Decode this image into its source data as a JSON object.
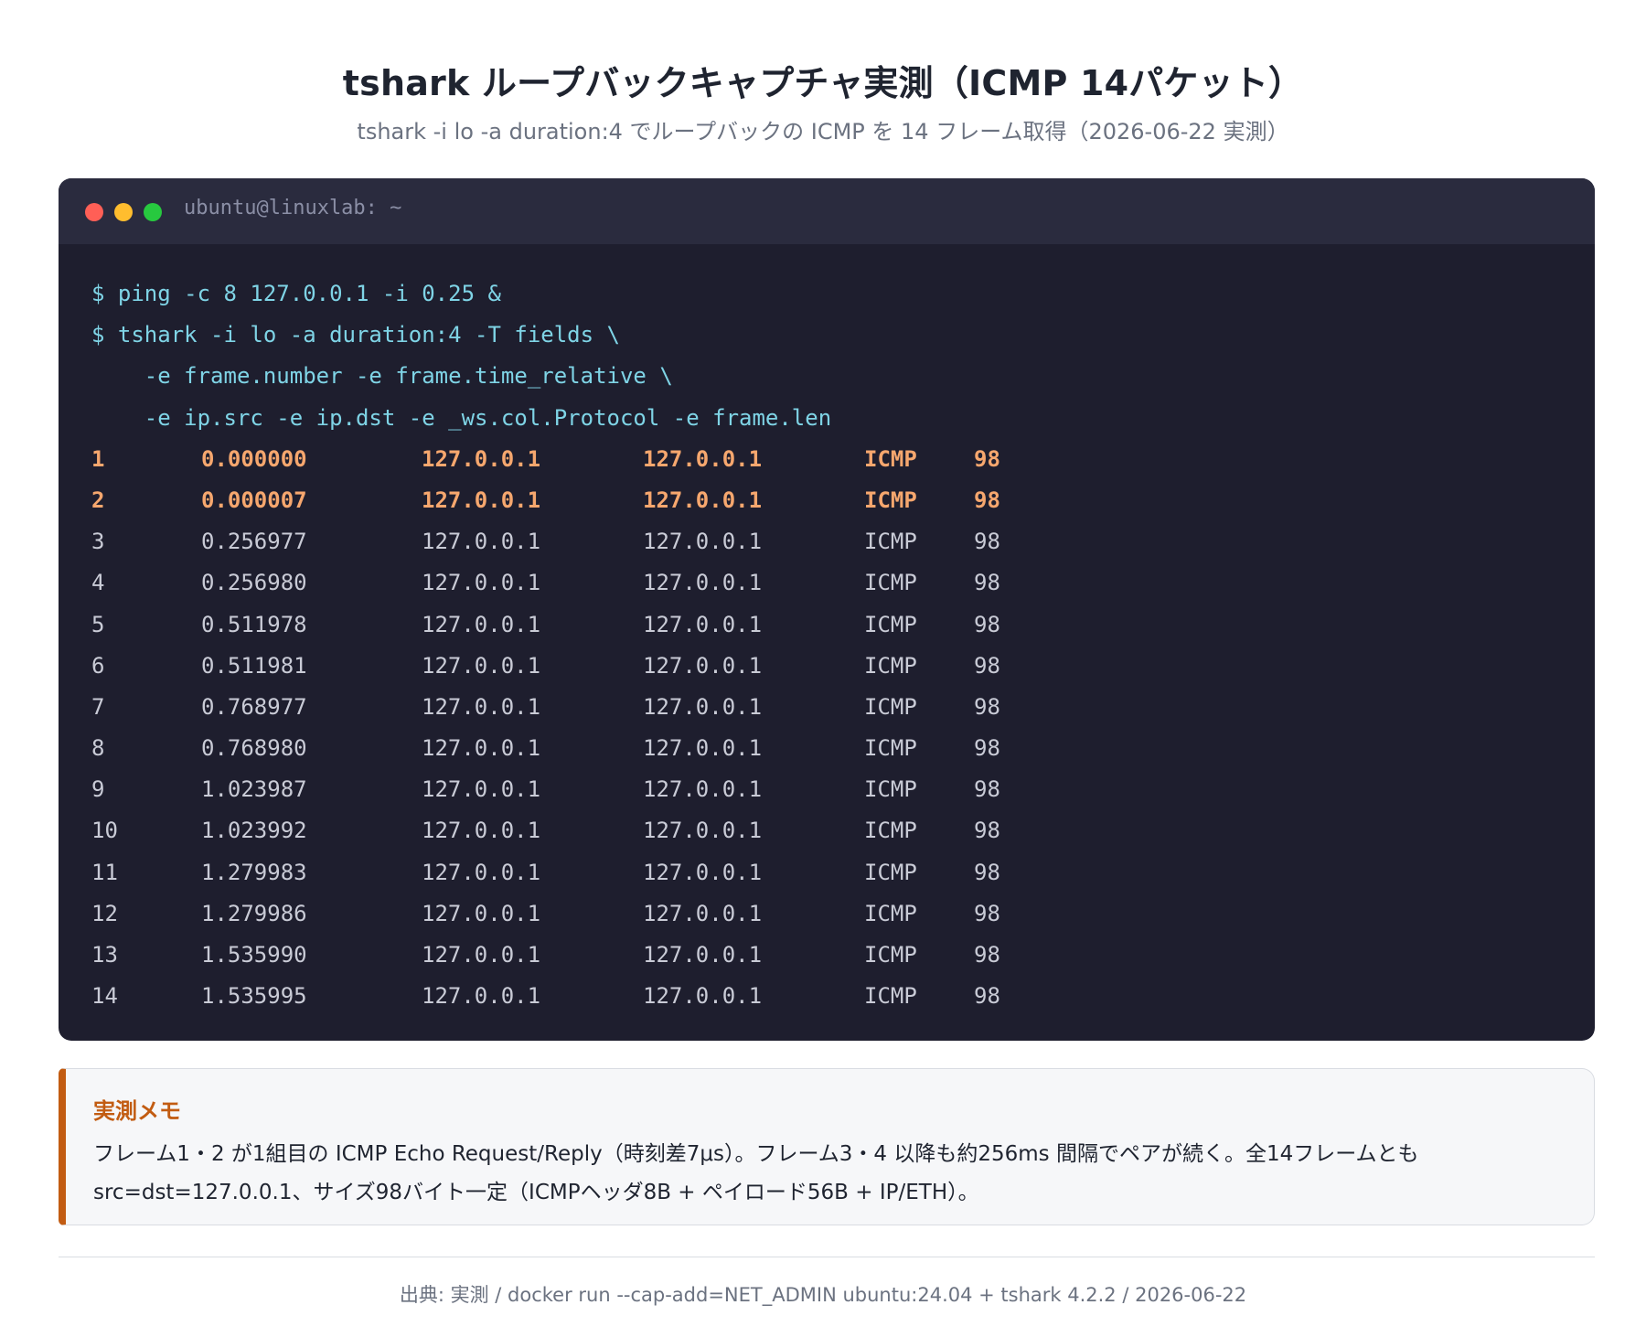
{
  "header": {
    "title": "tshark ループバックキャプチャ実測（ICMP 14パケット）",
    "subtitle": "tshark -i lo -a duration:4 でループバックの ICMP を 14 フレーム取得（2026-06-22 実測）"
  },
  "terminal": {
    "title": "ubuntu@linuxlab: ~",
    "commands": [
      "$ ping -c 8 127.0.0.1 -i 0.25 &",
      "$ tshark -i lo -a duration:4 -T fields \\",
      "    -e frame.number -e frame.time_relative \\",
      "    -e ip.src -e ip.dst -e _ws.col.Protocol -e frame.len"
    ],
    "rows": [
      {
        "num": "1",
        "time": "0.000000",
        "src": "127.0.0.1",
        "dst": "127.0.0.1",
        "proto": "ICMP",
        "len": "98",
        "highlight": true
      },
      {
        "num": "2",
        "time": "0.000007",
        "src": "127.0.0.1",
        "dst": "127.0.0.1",
        "proto": "ICMP",
        "len": "98",
        "highlight": true
      },
      {
        "num": "3",
        "time": "0.256977",
        "src": "127.0.0.1",
        "dst": "127.0.0.1",
        "proto": "ICMP",
        "len": "98",
        "highlight": false
      },
      {
        "num": "4",
        "time": "0.256980",
        "src": "127.0.0.1",
        "dst": "127.0.0.1",
        "proto": "ICMP",
        "len": "98",
        "highlight": false
      },
      {
        "num": "5",
        "time": "0.511978",
        "src": "127.0.0.1",
        "dst": "127.0.0.1",
        "proto": "ICMP",
        "len": "98",
        "highlight": false
      },
      {
        "num": "6",
        "time": "0.511981",
        "src": "127.0.0.1",
        "dst": "127.0.0.1",
        "proto": "ICMP",
        "len": "98",
        "highlight": false
      },
      {
        "num": "7",
        "time": "0.768977",
        "src": "127.0.0.1",
        "dst": "127.0.0.1",
        "proto": "ICMP",
        "len": "98",
        "highlight": false
      },
      {
        "num": "8",
        "time": "0.768980",
        "src": "127.0.0.1",
        "dst": "127.0.0.1",
        "proto": "ICMP",
        "len": "98",
        "highlight": false
      },
      {
        "num": "9",
        "time": "1.023987",
        "src": "127.0.0.1",
        "dst": "127.0.0.1",
        "proto": "ICMP",
        "len": "98",
        "highlight": false
      },
      {
        "num": "10",
        "time": "1.023992",
        "src": "127.0.0.1",
        "dst": "127.0.0.1",
        "proto": "ICMP",
        "len": "98",
        "highlight": false
      },
      {
        "num": "11",
        "time": "1.279983",
        "src": "127.0.0.1",
        "dst": "127.0.0.1",
        "proto": "ICMP",
        "len": "98",
        "highlight": false
      },
      {
        "num": "12",
        "time": "1.279986",
        "src": "127.0.0.1",
        "dst": "127.0.0.1",
        "proto": "ICMP",
        "len": "98",
        "highlight": false
      },
      {
        "num": "13",
        "time": "1.535990",
        "src": "127.0.0.1",
        "dst": "127.0.0.1",
        "proto": "ICMP",
        "len": "98",
        "highlight": false
      },
      {
        "num": "14",
        "time": "1.535995",
        "src": "127.0.0.1",
        "dst": "127.0.0.1",
        "proto": "ICMP",
        "len": "98",
        "highlight": false
      }
    ]
  },
  "memo": {
    "title": "実測メモ",
    "text": "フレーム1・2 が1組目の ICMP Echo Request/Reply（時刻差7μs）。フレーム3・4 以降も約256ms 間隔でペアが続く。全14フレームとも src=dst=127.0.0.1、サイズ98バイト一定（ICMPヘッダ8B + ペイロード56B + IP/ETH）。"
  },
  "footer": {
    "source": "出典: 実測 / docker run --cap-add=NET_ADMIN ubuntu:24.04 + tshark 4.2.2 / 2026-06-22"
  },
  "colors": {
    "terminal_bg": "#1e1e2e",
    "command": "#7fd4e6",
    "highlight_row": "#f6a76e",
    "memo_accent": "#c25c12"
  }
}
